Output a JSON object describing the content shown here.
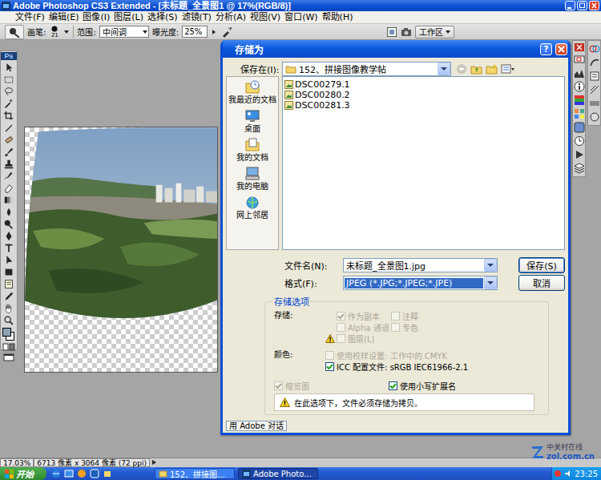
{
  "app": {
    "title": "Adobe Photoshop CS3 Extended - [未标题_全景图1 @ 17%(RGB/8)]",
    "logo": "Ps"
  },
  "menu": [
    "文件(F)",
    "编辑(E)",
    "图像(I)",
    "图层(L)",
    "选择(S)",
    "滤镜(T)",
    "分析(A)",
    "视图(V)",
    "窗口(W)",
    "帮助(H)"
  ],
  "options_bar": {
    "brush_label": "画笔:",
    "brush_size": "21",
    "range_label": "范围:",
    "range_value": "中间调",
    "exposure_label": "曝光度:",
    "exposure_value": "25%",
    "workspace": "工作区"
  },
  "dialog": {
    "title": "存储为",
    "help": "?",
    "save_in": {
      "label": "保存在(I):",
      "value": "152、拼接图像教学帖"
    },
    "places": [
      {
        "label": "我最近的文档",
        "selected": false
      },
      {
        "label": "桌面",
        "selected": false
      },
      {
        "label": "我的文档",
        "selected": false
      },
      {
        "label": "我的电脑",
        "selected": false
      },
      {
        "label": "网上邻居",
        "selected": false
      }
    ],
    "files": [
      {
        "name": "DSC00279.1",
        "selected": false
      },
      {
        "name": "DSC00280.2",
        "selected": false
      },
      {
        "name": "DSC00281.3",
        "selected": false
      }
    ],
    "file_name": {
      "label": "文件名(N):",
      "value": "未标题_全景图1.jpg"
    },
    "format": {
      "label": "格式(F):",
      "value": "JPEG (*.JPG;*.JPEG;*.JPE)",
      "selected": true
    },
    "buttons": [
      {
        "label": "保存(S)",
        "default": true
      },
      {
        "label": "取消",
        "default": false
      }
    ],
    "options": {
      "title": "存储选项",
      "save_label": "存储:",
      "save_checks": [
        {
          "label": "作为副本",
          "checked": true,
          "disabled": true,
          "warning": false
        },
        {
          "label": "注释",
          "checked": false,
          "disabled": true,
          "warning": false
        },
        {
          "label": "Alpha 通道",
          "checked": false,
          "disabled": true,
          "warning": false
        },
        {
          "label": "专色",
          "checked": false,
          "disabled": true,
          "warning": false
        },
        {
          "label": "图层(L)",
          "checked": false,
          "disabled": true,
          "warning": true
        }
      ],
      "color_label": "颜色:",
      "color_checks": [
        {
          "label": "使用校样设置: 工作中的 CMYK",
          "checked": false,
          "disabled": true
        },
        {
          "label": "ICC 配置文件: sRGB IEC61966-2.1",
          "checked": true,
          "disabled": false
        }
      ],
      "bottom_checks": [
        {
          "label": "缩览图",
          "checked": true,
          "disabled": true
        },
        {
          "label": "使用小写扩展名",
          "checked": true,
          "disabled": false
        }
      ],
      "warning": "在此选项下，文件必须存储为拷贝。"
    },
    "adobe_dialog_button": "用 Adobe 对话"
  },
  "status_bar": {
    "zoom": "17.03%",
    "info": "6713 像素 x 3064 像素 (72 ppi)"
  },
  "taskbar": {
    "start": "开始",
    "tasks": [
      {
        "label": "152、拼接图...",
        "selected": false
      },
      {
        "label": "Adobe Photo...",
        "selected": true
      }
    ],
    "clock": "23:25"
  },
  "watermark": {
    "brand": "中关村在线",
    "url": "zol.com.cn"
  }
}
